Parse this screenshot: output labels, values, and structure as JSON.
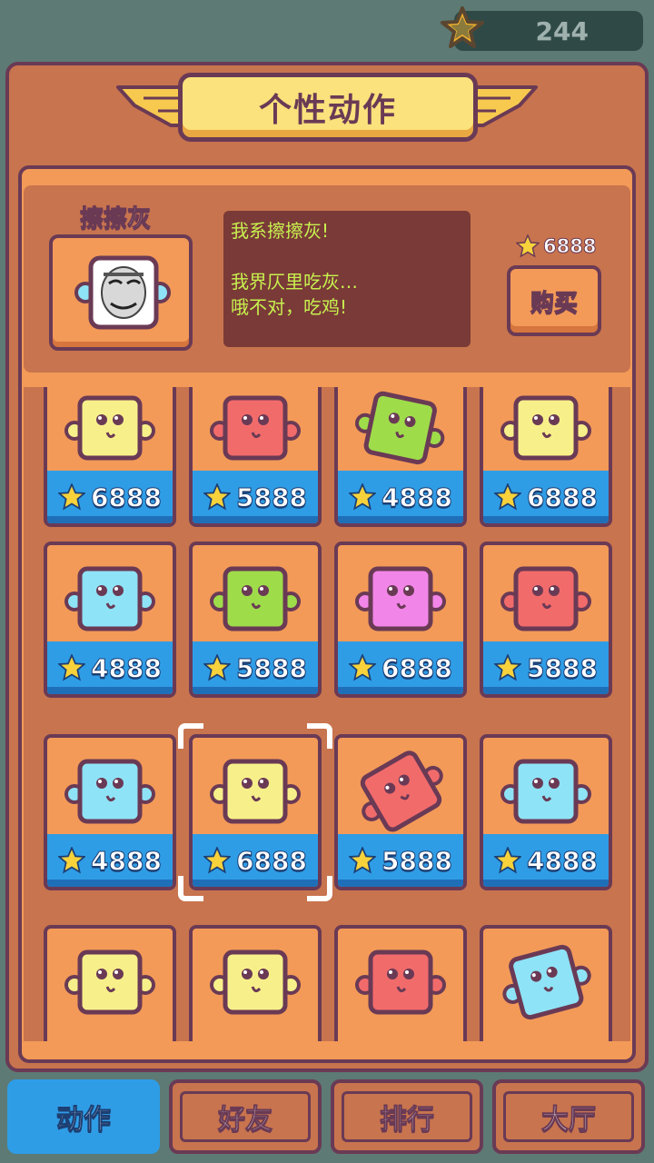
{
  "coins": {
    "value": "244"
  },
  "title": "个性动作",
  "selected": {
    "name": "擦擦灰",
    "description": "我系擦擦灰!\n\n我界仄里吃灰…\n哦不对，吃鸡!",
    "price": "6888",
    "buy_label": "购买"
  },
  "items": [
    {
      "price": "6888",
      "color": "#f7f08a",
      "tilt": 0
    },
    {
      "price": "5888",
      "color": "#f26b6b",
      "tilt": 0
    },
    {
      "price": "4888",
      "color": "#9fdc4a",
      "tilt": 12
    },
    {
      "price": "6888",
      "color": "#f7f08a",
      "tilt": 0
    },
    {
      "price": "4888",
      "color": "#8fe3f6",
      "tilt": 0
    },
    {
      "price": "5888",
      "color": "#9fdc4a",
      "tilt": 0
    },
    {
      "price": "6888",
      "color": "#f286e8",
      "tilt": 0
    },
    {
      "price": "5888",
      "color": "#f26b6b",
      "tilt": 0
    },
    {
      "price": "4888",
      "color": "#8fe3f6",
      "tilt": 0
    },
    {
      "price": "6888",
      "color": "#f7f08a",
      "tilt": 0
    },
    {
      "price": "5888",
      "color": "#f26b6b",
      "tilt": -30
    },
    {
      "price": "4888",
      "color": "#8fe3f6",
      "tilt": 0
    },
    {
      "price": "",
      "color": "#f7f08a",
      "tilt": 0
    },
    {
      "price": "",
      "color": "#f7f08a",
      "tilt": 0
    },
    {
      "price": "",
      "color": "#f26b6b",
      "tilt": 0
    },
    {
      "price": "",
      "color": "#8fe3f6",
      "tilt": -15
    }
  ],
  "selected_item_index": 9,
  "tabs": [
    {
      "label": "动作",
      "active": true
    },
    {
      "label": "好友",
      "active": false
    },
    {
      "label": "排行",
      "active": false
    },
    {
      "label": "大厅",
      "active": false
    }
  ]
}
